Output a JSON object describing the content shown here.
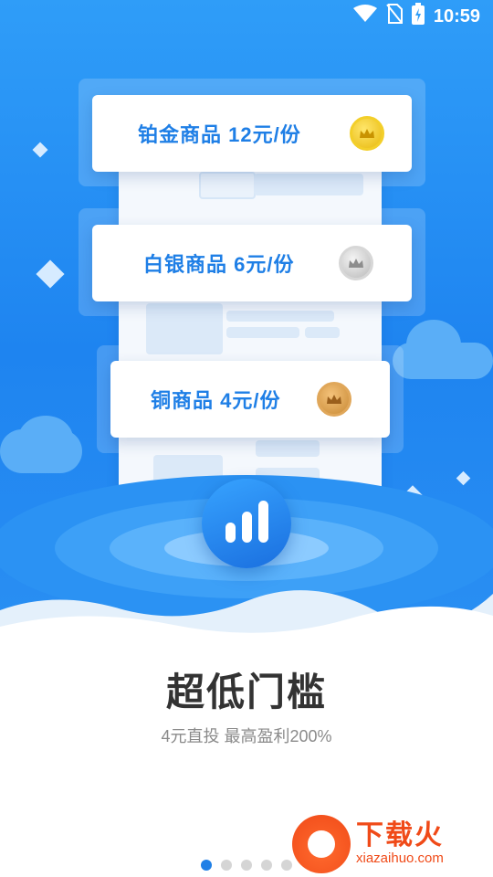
{
  "status": {
    "time": "10:59",
    "icons": [
      "wifi-icon",
      "no-sim-icon",
      "battery-charging-icon"
    ]
  },
  "cards": [
    {
      "label": "铂金商品  12元/份",
      "coin": "gold-coin-icon"
    },
    {
      "label": "白银商品  6元/份",
      "coin": "silver-coin-icon"
    },
    {
      "label": "铜商品  4元/份",
      "coin": "bronze-coin-icon"
    }
  ],
  "main": {
    "title": "超低门槛",
    "subtitle": "4元直投 最高盈利200%"
  },
  "pager": {
    "count": 5,
    "active_index": 0
  },
  "watermark": {
    "cn": "下载火",
    "en": "xiazaihuo.com"
  },
  "colors": {
    "accent": "#1f7fe6",
    "hero_bg": "#2f9df8",
    "gold": "#e8b90d",
    "silver": "#b9b9b9",
    "bronze": "#c98a35"
  }
}
